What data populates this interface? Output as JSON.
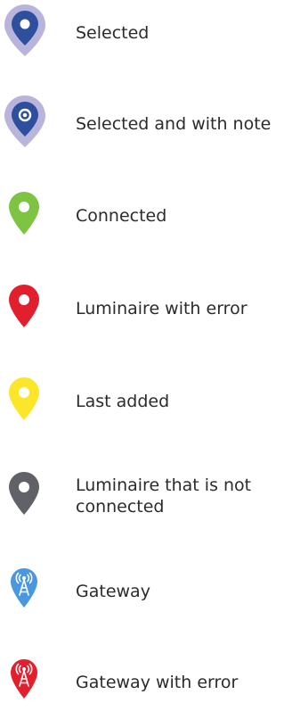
{
  "legend": {
    "items": [
      {
        "label": "Selected",
        "icon": "selected-pin-icon",
        "color": "#2E4F9E",
        "halo": "#B8B4DC"
      },
      {
        "label": "Selected and with note",
        "icon": "selected-note-pin-icon",
        "color": "#2E4F9E",
        "halo": "#B8B4DC"
      },
      {
        "label": "Connected",
        "icon": "connected-pin-icon",
        "color": "#7DC443"
      },
      {
        "label": "Luminaire with error",
        "icon": "error-pin-icon",
        "color": "#E2202D"
      },
      {
        "label": "Last added",
        "icon": "last-added-pin-icon",
        "color": "#FBE62A"
      },
      {
        "label": "Luminaire that is not connected",
        "icon": "not-connected-pin-icon",
        "color": "#606268"
      },
      {
        "label": "Gateway",
        "icon": "gateway-icon",
        "color": "#4B97DE"
      },
      {
        "label": "Gateway with error",
        "icon": "gateway-error-icon",
        "color": "#E2202D"
      }
    ]
  }
}
